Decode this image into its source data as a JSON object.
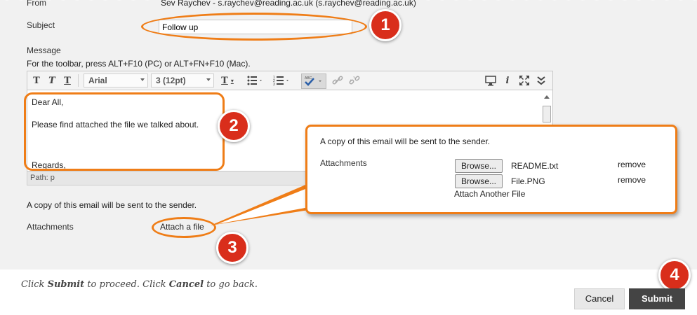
{
  "form": {
    "from_label": "From",
    "from_value": "Sev Raychev - s.raychev@reading.ac.uk (s.raychev@reading.ac.uk)",
    "subject_label": "Subject",
    "subject_value": "Follow up",
    "message_label": "Message",
    "toolbar_hint": "For the toolbar, press ALT+F10 (PC) or ALT+FN+F10 (Mac).",
    "font_family": "Arial",
    "font_size": "3 (12pt)",
    "body_lines": [
      "Dear All,",
      "Please find attached the file we talked about.",
      "Regards,"
    ],
    "path_label": "Path:",
    "path_value": "p",
    "copy_notice": "A copy of this email will be sent to the sender.",
    "attachments_label": "Attachments",
    "attach_link": "Attach a file"
  },
  "toolbar_icons": {
    "bold": "T",
    "italic": "T",
    "underline": "T",
    "text_color": "T",
    "spellcheck": "ABC",
    "preview": "monitor-icon",
    "info": "i",
    "fullscreen": "expand-icon",
    "collapse": "double-chevron-icon"
  },
  "panel": {
    "copy_notice": "A copy of this email will be sent to the sender.",
    "attachments_label": "Attachments",
    "files": [
      {
        "browse": "Browse...",
        "name": "README.txt",
        "remove": "remove"
      },
      {
        "browse": "Browse...",
        "name": "File.PNG",
        "remove": "remove"
      }
    ],
    "attach_another": "Attach Another File"
  },
  "badges": [
    "1",
    "2",
    "3",
    "4"
  ],
  "footer": {
    "hint_prefix": "Click ",
    "hint_submit": "Submit",
    "hint_mid": " to proceed. Click ",
    "hint_cancel": "Cancel",
    "hint_suffix": " to go back.",
    "cancel_label": "Cancel",
    "submit_label": "Submit"
  },
  "colors": {
    "accent_orange": "#ef7d17",
    "badge_red": "#d92e1b",
    "submit_bg": "#444444"
  }
}
